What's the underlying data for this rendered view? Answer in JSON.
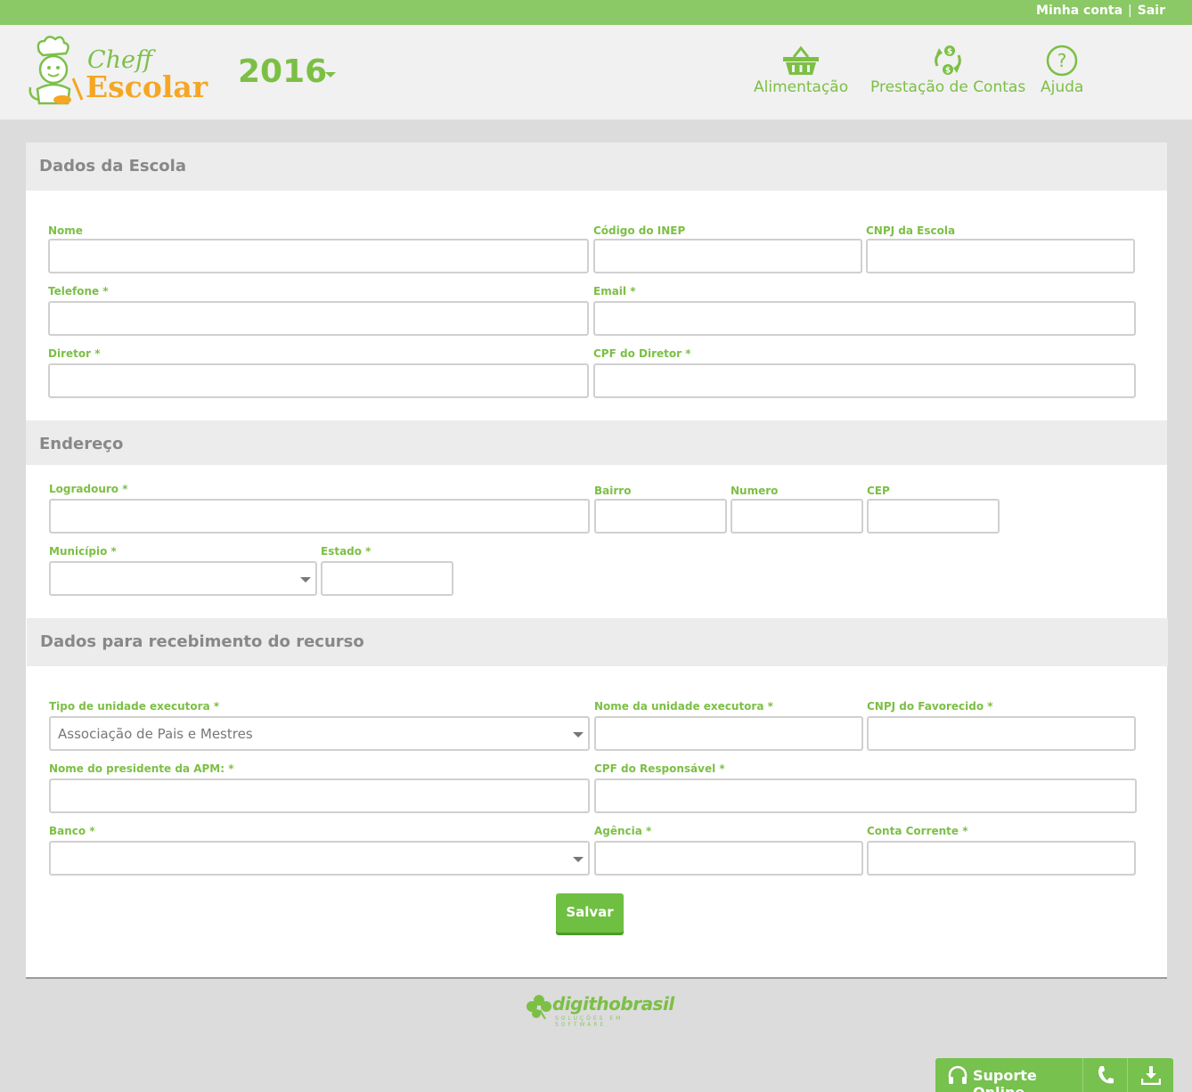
{
  "topbar": {
    "account": "Minha conta",
    "separator": "|",
    "logout": "Sair"
  },
  "logo": {
    "line1": "Cheff",
    "line2": "Escolar"
  },
  "year": {
    "value": "2016"
  },
  "nav": {
    "food": "Alimentação",
    "accounts": "Prestação de Contas",
    "help": "Ajuda"
  },
  "sections": {
    "school": {
      "title": "Dados da Escola",
      "fields": {
        "nome": "Nome",
        "inep": "Código do INEP",
        "cnpj": "CNPJ da Escola",
        "telefone": "Telefone  *",
        "email": "Email  *",
        "diretor": "Diretor  *",
        "cpf_diretor": "CPF do Diretor  *"
      }
    },
    "address": {
      "title": "Endereço",
      "fields": {
        "logradouro": "Logradouro  *",
        "bairro": "Bairro",
        "numero": "Numero",
        "cep": "CEP",
        "municipio": "Município  *",
        "estado": "Estado  *"
      }
    },
    "funds": {
      "title": "Dados para recebimento do recurso",
      "fields": {
        "tipo_unidade": "Tipo de unidade executora  *",
        "tipo_unidade_value": "Associação de Pais e Mestres",
        "nome_unidade": "Nome da unidade executora  *",
        "cnpj_favorecido": "CNPJ do Favorecido  *",
        "presidente": "Nome do presidente da APM:  *",
        "cpf_responsavel": "CPF do Responsável  *",
        "banco": "Banco  *",
        "agencia": "Agência  *",
        "conta": "Conta Corrente  *"
      }
    }
  },
  "actions": {
    "save": "Salvar"
  },
  "footer": {
    "brand": "digithobrasil",
    "tagline": "SOLUÇÕES EM SOFTWARE"
  },
  "support": {
    "label": "Suporte Online"
  },
  "colors": {
    "green": "#7cbf45",
    "topbar": "#8bc866",
    "logo_orange": "#f5a623"
  }
}
